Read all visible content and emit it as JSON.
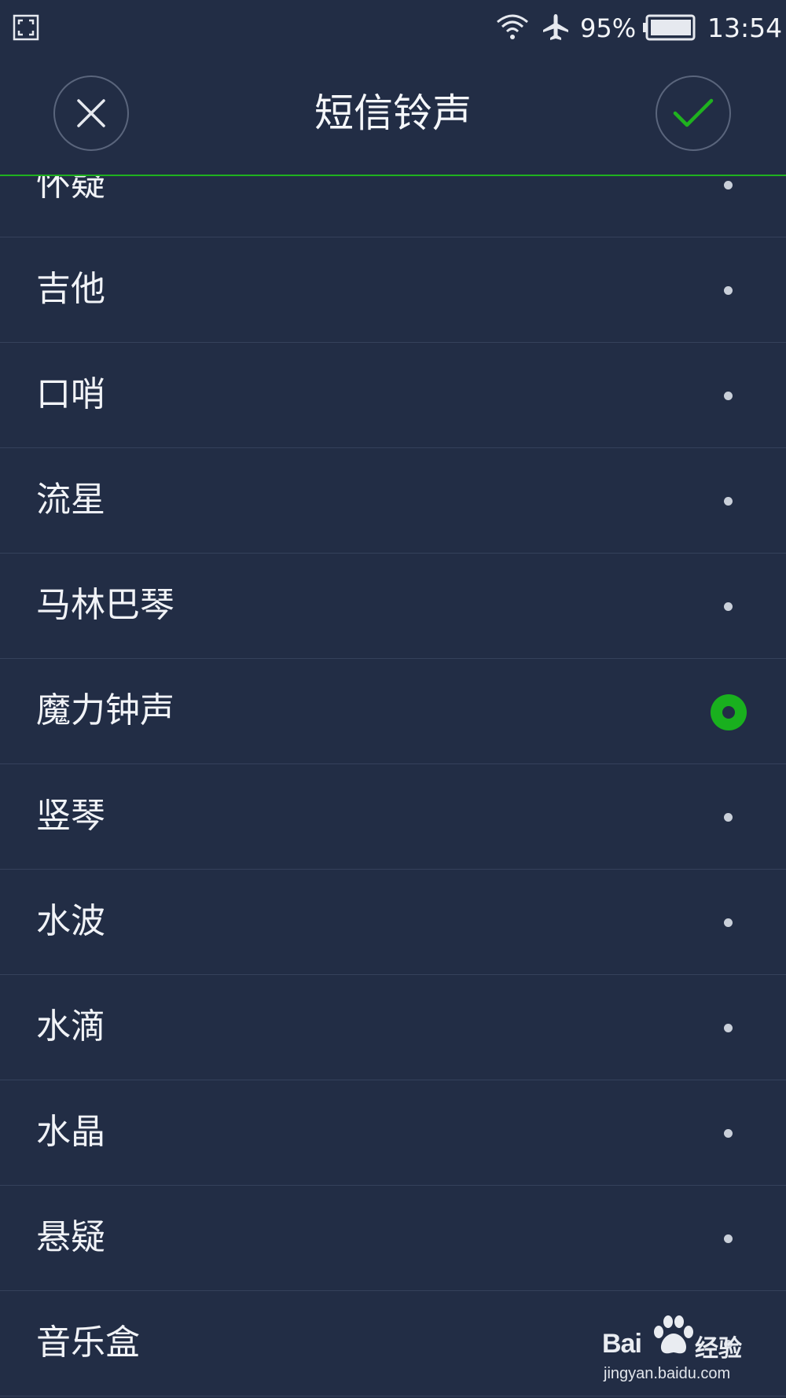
{
  "status_bar": {
    "battery_percent": "95%",
    "time": "13:54",
    "icons": [
      "screenshot-frame-icon",
      "wifi-icon",
      "airplane-mode-icon",
      "battery-icon"
    ]
  },
  "header": {
    "title": "短信铃声",
    "close_icon": "close-icon",
    "confirm_icon": "check-icon"
  },
  "colors": {
    "background": "#222d45",
    "accent": "#1fb21f",
    "divider": "#35415b"
  },
  "ringtones": [
    {
      "label": "怀疑",
      "selected": false
    },
    {
      "label": "吉他",
      "selected": false
    },
    {
      "label": "口哨",
      "selected": false
    },
    {
      "label": "流星",
      "selected": false
    },
    {
      "label": "马林巴琴",
      "selected": false
    },
    {
      "label": "魔力钟声",
      "selected": true
    },
    {
      "label": "竖琴",
      "selected": false
    },
    {
      "label": "水波",
      "selected": false
    },
    {
      "label": "水滴",
      "selected": false
    },
    {
      "label": "水晶",
      "selected": false
    },
    {
      "label": "悬疑",
      "selected": false
    },
    {
      "label": "音乐盒",
      "selected": false
    }
  ],
  "watermark": {
    "brand": "Bai",
    "brand_suffix": "经验",
    "url": "jingyan.baidu.com"
  }
}
